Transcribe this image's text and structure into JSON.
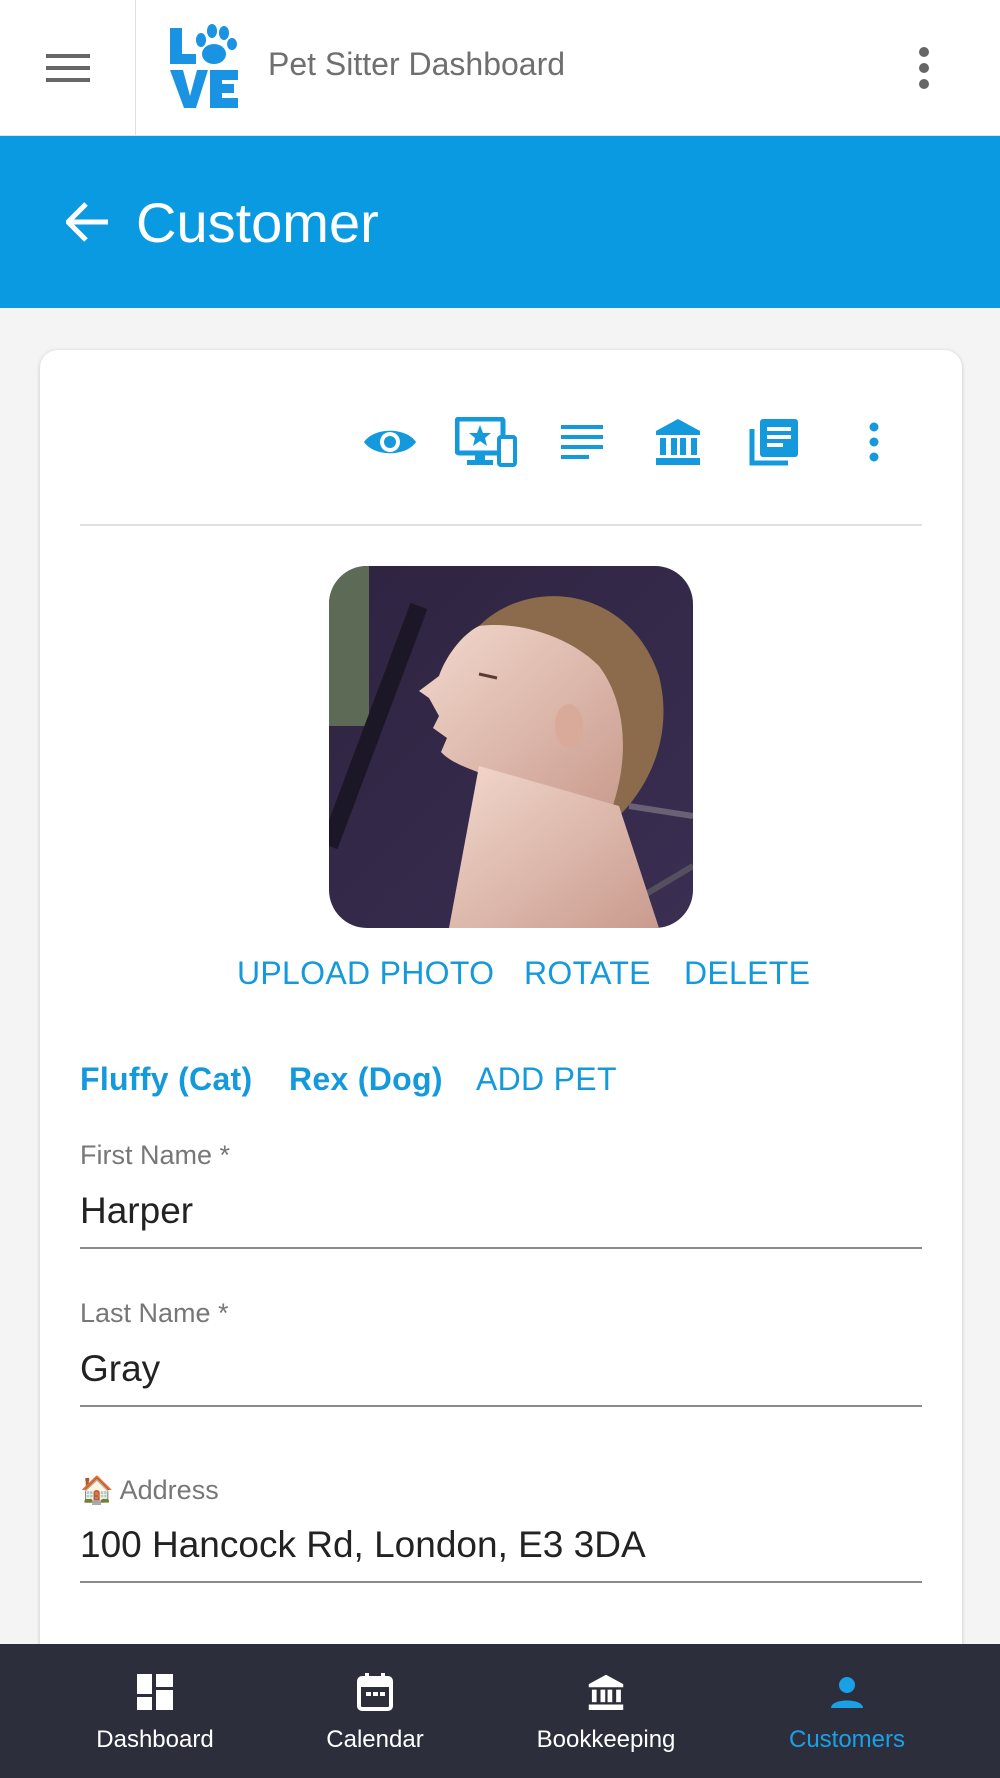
{
  "app": {
    "title": "Pet Sitter Dashboard",
    "logo_text": "LOVE"
  },
  "header": {
    "title": "Customer"
  },
  "card": {
    "toolbar_icons": [
      "eye-icon",
      "devices-star-icon",
      "text-lines-icon",
      "bank-icon",
      "article-stack-icon",
      "more-vert-icon"
    ],
    "photo_actions": {
      "upload": "UPLOAD PHOTO",
      "rotate": "ROTATE",
      "delete": "DELETE"
    },
    "pets": [
      {
        "label": "Fluffy (Cat)"
      },
      {
        "label": "Rex (Dog)"
      }
    ],
    "add_pet": "ADD PET",
    "fields": {
      "first_name": {
        "label": "First Name *",
        "value": "Harper"
      },
      "last_name": {
        "label": "Last Name *",
        "value": "Gray"
      },
      "address": {
        "icon": "🏠",
        "label": "Address",
        "value": "100 Hancock Rd, London, E3 3DA"
      }
    }
  },
  "bottom_nav": {
    "items": [
      {
        "label": "Dashboard",
        "icon": "dashboard-icon"
      },
      {
        "label": "Calendar",
        "icon": "calendar-icon"
      },
      {
        "label": "Bookkeeping",
        "icon": "bank-icon"
      },
      {
        "label": "Customers",
        "icon": "person-icon",
        "active": true
      }
    ]
  },
  "colors": {
    "primary": "#0a9ae2",
    "accent_text": "#1499dc",
    "nav_bg": "#2c2f3b",
    "active_nav": "#1aa0e6"
  }
}
